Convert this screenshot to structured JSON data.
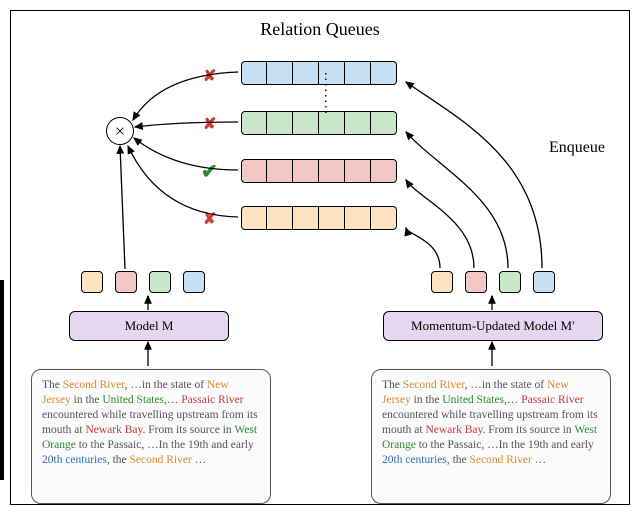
{
  "title": "Relation Queues",
  "enqueue_label": "Enqueue",
  "dots": "........",
  "model_left_label": "Model M",
  "model_right_label": "Momentum-Updated Model M′",
  "marks": {
    "x": "✘",
    "check": "✔"
  },
  "otimes": "×",
  "queues": {
    "blue_cells": 6,
    "green_cells": 6,
    "red_cells": 6,
    "orange_cells": 6
  },
  "outputs_left": [
    "orange",
    "red",
    "green",
    "blue"
  ],
  "outputs_right": [
    "orange",
    "red",
    "green",
    "blue"
  ],
  "passage": {
    "pre1": "The ",
    "second_river": "Second River",
    "t1": ", …in the state of ",
    "new_jersey": "New Jersey",
    "t2": " in the ",
    "united_states": "United States",
    "t3": ",… ",
    "passaic_river": "Passaic River",
    "t4": " encountered while travelling upstream from its mouth at ",
    "newark_bay": "Newark Bay",
    "t5": ". From its source in ",
    "west_orange": "West Orange",
    "t6": " to the Passaic, …In the 19th and early ",
    "century": "20th centuries",
    "t7": ", the ",
    "second_river2": "Second River",
    "t8": " …"
  },
  "chart_data": {
    "type": "diagram",
    "title": "Relation Queues",
    "components": [
      {
        "id": "model_M",
        "label": "Model M",
        "outputs": [
          "orange",
          "red",
          "green",
          "blue"
        ]
      },
      {
        "id": "model_M_prime",
        "label": "Momentum-Updated Model M′",
        "outputs": [
          "orange",
          "red",
          "green",
          "blue"
        ]
      },
      {
        "id": "queues",
        "colors": [
          "blue",
          "green",
          "red",
          "orange"
        ],
        "cells_each": 6,
        "stacked_vertically": true,
        "ellipsis_between": [
          "blue",
          "green"
        ]
      },
      {
        "id": "otimes",
        "op": "contrastive-/dot-product"
      }
    ],
    "edges": [
      {
        "from": "panel_left",
        "to": "model_M",
        "type": "arrow"
      },
      {
        "from": "panel_right",
        "to": "model_M_prime",
        "type": "arrow"
      },
      {
        "from": "model_M.outputs.red",
        "to": "otimes",
        "type": "arrow"
      },
      {
        "from": "queue.blue.left",
        "to": "otimes",
        "type": "arrow",
        "mark": "x"
      },
      {
        "from": "queue.green.left",
        "to": "otimes",
        "type": "arrow",
        "mark": "x"
      },
      {
        "from": "queue.red.left",
        "to": "otimes",
        "type": "arrow",
        "mark": "check"
      },
      {
        "from": "queue.orange.left",
        "to": "otimes",
        "type": "arrow",
        "mark": "x"
      },
      {
        "from": "model_M_prime.outputs.orange",
        "to": "queue.orange.right",
        "type": "curve",
        "label": "Enqueue"
      },
      {
        "from": "model_M_prime.outputs.red",
        "to": "queue.red.right",
        "type": "curve"
      },
      {
        "from": "model_M_prime.outputs.green",
        "to": "queue.green.right",
        "type": "curve"
      },
      {
        "from": "model_M_prime.outputs.blue",
        "to": "queue.blue.right",
        "type": "curve"
      }
    ]
  }
}
